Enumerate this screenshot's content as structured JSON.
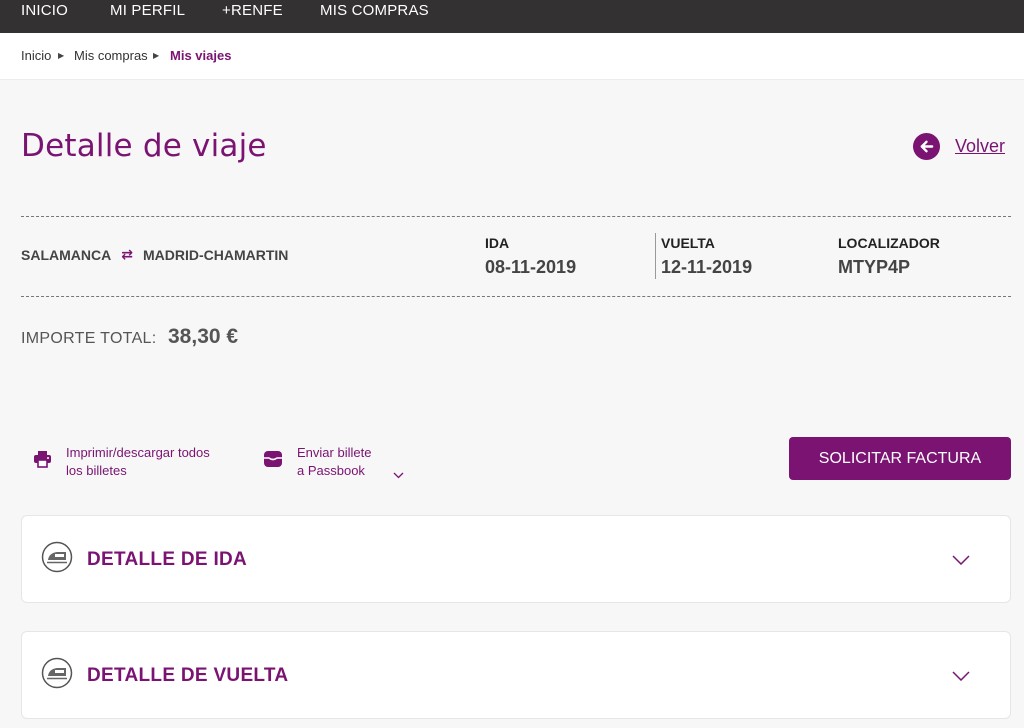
{
  "nav": {
    "items": [
      "INICIO",
      "MI PERFIL",
      "+RENFE",
      "MIS COMPRAS"
    ]
  },
  "breadcrumb": {
    "items": [
      "Inicio",
      "Mis compras"
    ],
    "current": "Mis viajes"
  },
  "page": {
    "title": "Detalle de viaje",
    "back_label": "Volver"
  },
  "trip": {
    "origin": "SALAMANCA",
    "destination": "MADRID-CHAMARTIN",
    "ida_label": "IDA",
    "ida_date": "08-11-2019",
    "vuelta_label": "VUELTA",
    "vuelta_date": "12-11-2019",
    "localizador_label": "LOCALIZADOR",
    "localizador": "MTYP4P"
  },
  "total": {
    "label": "IMPORTE TOTAL:",
    "value": "38,30 €"
  },
  "actions": {
    "print_line1": "Imprimir/descargar todos",
    "print_line2": "los billetes",
    "passbook_line1": "Enviar billete",
    "passbook_line2": "a Passbook",
    "factura": "SOLICITAR FACTURA"
  },
  "sections": {
    "ida": "DETALLE DE IDA",
    "vuelta": "DETALLE DE VUELTA"
  },
  "icons": [
    "arrow-left-icon",
    "swap-arrows-icon",
    "printer-icon",
    "wallet-icon",
    "chevron-down-icon",
    "train-icon"
  ],
  "colors": {
    "brand": "#7a1372",
    "topbar": "#333132",
    "background": "#f7f7f7"
  }
}
